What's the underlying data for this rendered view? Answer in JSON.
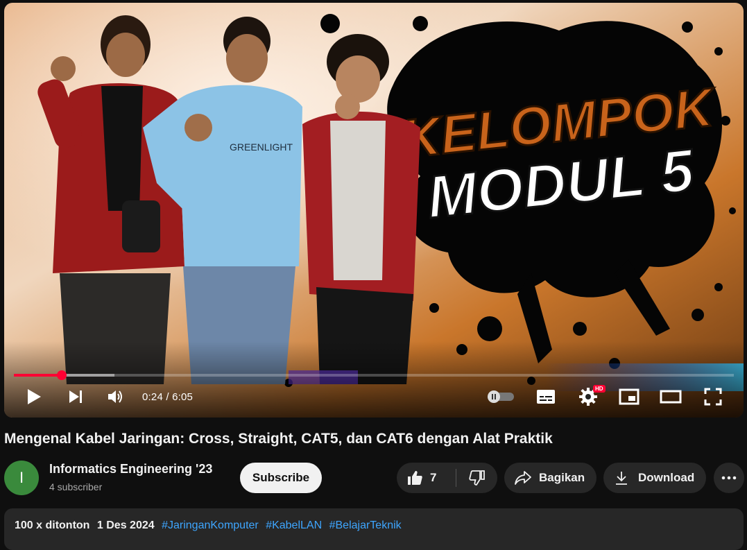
{
  "player": {
    "time_display": "0:24 / 6:05",
    "progress_fraction": 0.066,
    "buffered_fraction": 0.14,
    "hd_badge": "HD",
    "thumbnail_text": {
      "line1": "KELOMPOK",
      "line2": "MODUL 5"
    },
    "hoodie_text": "GREENLIGHT",
    "controls": [
      "play-icon",
      "next-icon",
      "volume-icon",
      "autoplay-toggle",
      "subtitles-icon",
      "settings-icon",
      "miniplayer-icon",
      "theater-icon",
      "fullscreen-icon"
    ]
  },
  "video": {
    "title": "Mengenal Kabel Jaringan: Cross, Straight, CAT5, dan CAT6 dengan Alat Praktik"
  },
  "channel": {
    "avatar_letter": "I",
    "avatar_color": "#3a8a3c",
    "name": "Informatics Engineering '23",
    "subscribers": "4 subscriber",
    "subscribe_label": "Subscribe"
  },
  "actions": {
    "like_count": "7",
    "share_label": "Bagikan",
    "download_label": "Download"
  },
  "description": {
    "views": "100 x ditonton",
    "date": "1 Des 2024",
    "hashtags": [
      "#JaringanKomputer",
      "#KabelLAN",
      "#BelajarTeknik"
    ]
  },
  "colors": {
    "background": "#0f0f0f",
    "accent_red": "#ff0033",
    "link_blue": "#3ea6ff",
    "pill_bg": "#272727"
  }
}
